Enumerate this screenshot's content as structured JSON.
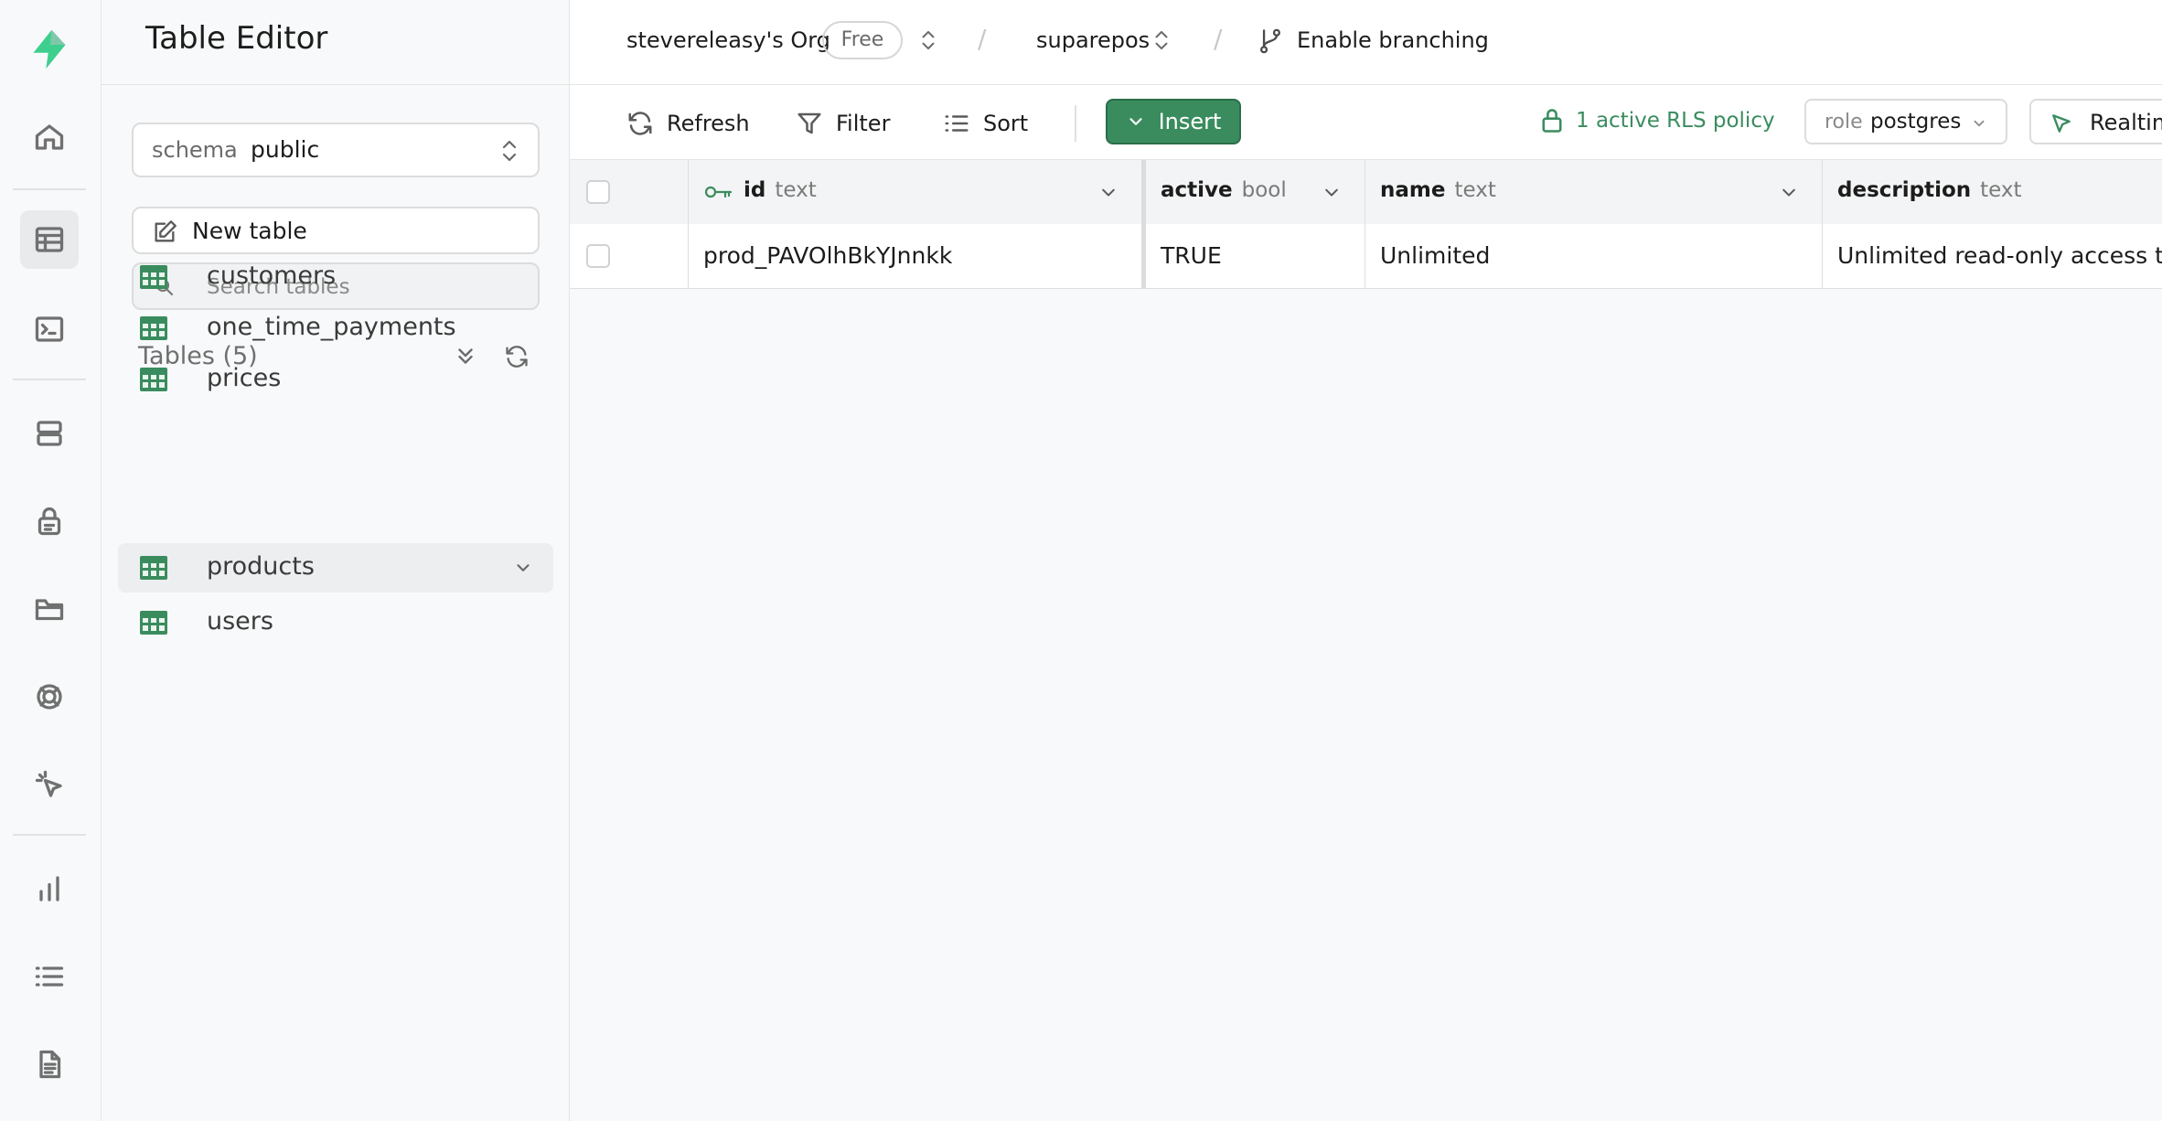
{
  "sidebar": {
    "title": "Table Editor",
    "schema": {
      "label": "schema",
      "value": "public"
    },
    "new_table_label": "New table",
    "search": {
      "placeholder": "Search tables"
    },
    "tables_heading": "Tables (5)",
    "tables": [
      {
        "label": "customers"
      },
      {
        "label": "one_time_payments"
      },
      {
        "label": "prices"
      },
      {
        "label": "products",
        "selected": true
      },
      {
        "label": "users"
      }
    ]
  },
  "topbar": {
    "org": "stevereleasy's Org",
    "plan": "Free",
    "project": "suparepos",
    "branching": "Enable branching"
  },
  "toolbar": {
    "refresh": "Refresh",
    "filter": "Filter",
    "sort": "Sort",
    "insert": "Insert",
    "rls": "1 active RLS policy",
    "role_label": "role",
    "role_value": "postgres",
    "realtime": "Realtim"
  },
  "grid": {
    "columns": [
      {
        "name": "id",
        "type": "text",
        "primary_key": true
      },
      {
        "name": "active",
        "type": "bool"
      },
      {
        "name": "name",
        "type": "text"
      },
      {
        "name": "description",
        "type": "text"
      }
    ],
    "rows": [
      [
        "prod_PAVOlhBkYJnnkk",
        "TRUE",
        "Unlimited",
        "Unlimited read-only access to"
      ]
    ]
  },
  "colors": {
    "accent": "#3a8c5e",
    "table_icon": "#3a8c5e"
  }
}
